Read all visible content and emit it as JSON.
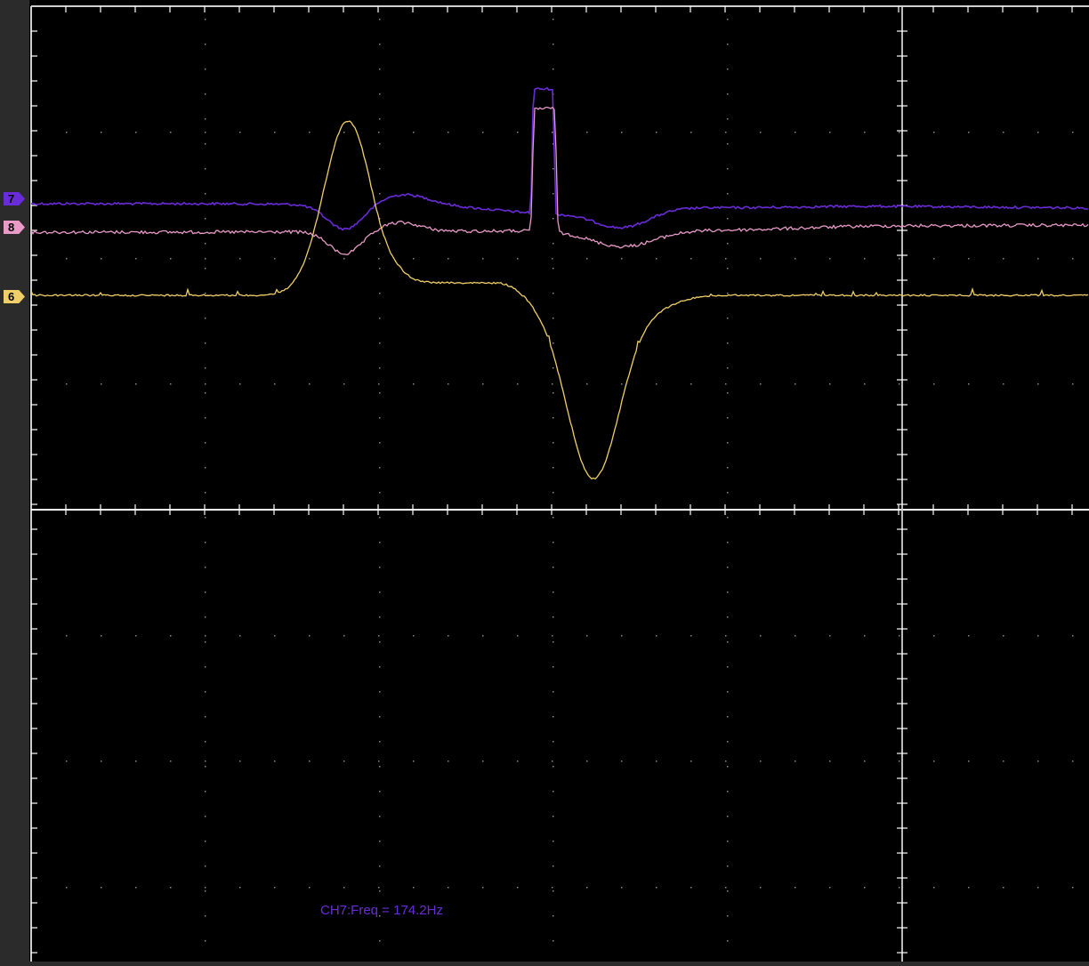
{
  "colors": {
    "background": "#000000",
    "left_strip": "#2b2b2b",
    "grid_lines": "#ffffff",
    "grid_dots": "#8a8a8a",
    "ch7": "#6a2bd8",
    "ch8": "#e89ac8",
    "ch6": "#f0cf68"
  },
  "channels": [
    {
      "id": "ch7",
      "label": "7",
      "color": "#6a2bd8"
    },
    {
      "id": "ch8",
      "label": "8",
      "color": "#e89ac8"
    },
    {
      "id": "ch6",
      "label": "6",
      "color": "#f0cf68"
    }
  ],
  "measurement": {
    "text": "CH7:Freq = 174.2Hz"
  }
}
